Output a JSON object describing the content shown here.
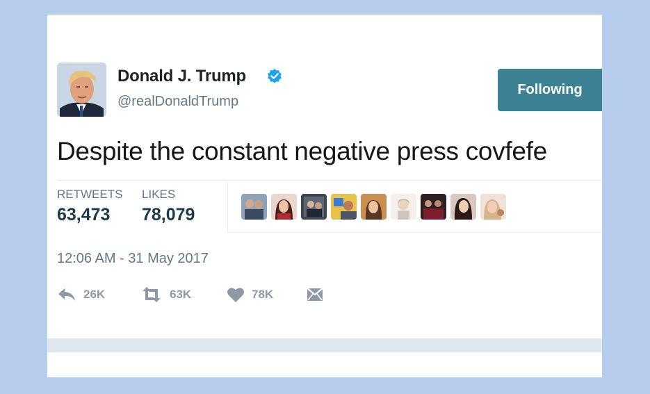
{
  "user": {
    "display_name": "Donald J. Trump",
    "handle": "@realDonaldTrump",
    "verified": true
  },
  "follow_button": {
    "label": "Following"
  },
  "tweet": {
    "text": "Despite the constant negative press covfefe",
    "timestamp": "12:06 AM - 31 May 2017"
  },
  "stats": {
    "retweets_label": "RETWEETS",
    "retweets_value": "63,473",
    "likes_label": "LIKES",
    "likes_value": "78,079"
  },
  "actions": {
    "reply_count": "26K",
    "retweet_count": "63K",
    "like_count": "78K"
  },
  "icons": {
    "reply": "reply-icon",
    "retweet": "retweet-icon",
    "like": "heart-icon",
    "message": "direct-message-icon",
    "verified": "verified-badge-icon"
  },
  "colors": {
    "background": "#b7cdee",
    "card": "#ffffff",
    "follow_button": "#3d8294",
    "verified": "#1da1f2",
    "muted_text": "#657786",
    "stat_value": "#1b3a4b",
    "action_icon": "#8d9aa6"
  }
}
